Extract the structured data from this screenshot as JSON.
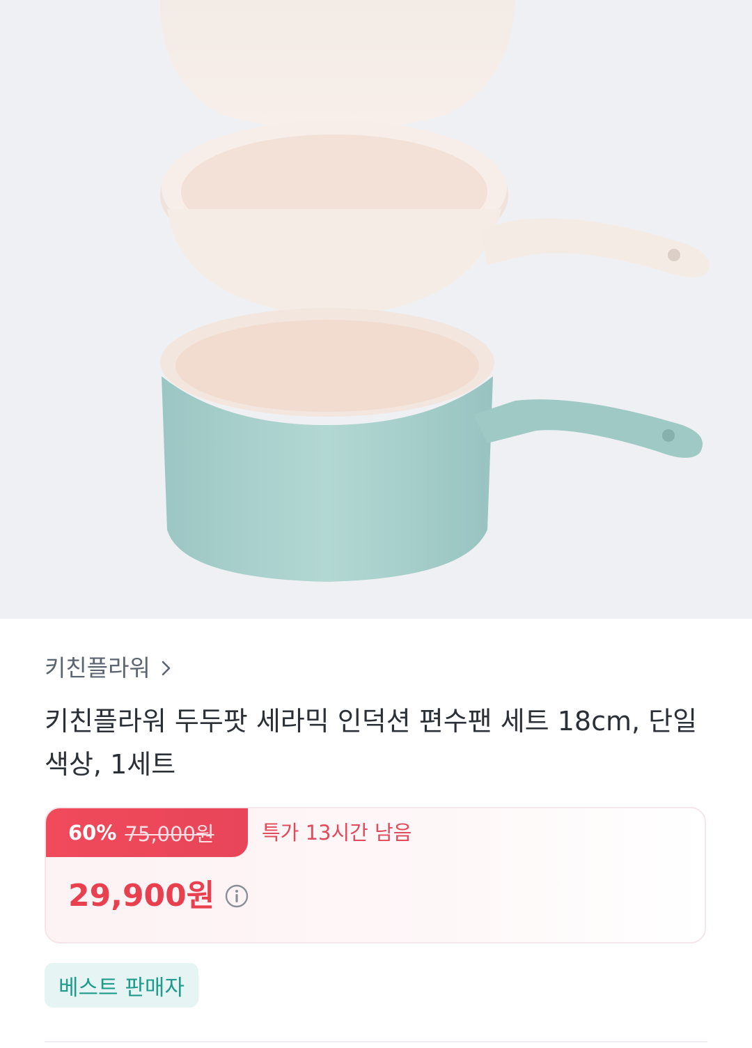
{
  "product": {
    "image_alt": "product-image",
    "brand": "키친플라워",
    "title": "키친플라워 두두팟 세라믹 인덕션 편수팬 세트 18cm, 단일색상, 1세트",
    "discount_rate": "60%",
    "original_price": "75,000원",
    "deal_timer": "특가 13시간 남음",
    "sale_price": "29,900원",
    "seller_badge": "베스트 판매자"
  },
  "colors": {
    "accent_red": "#e8404f",
    "badge_green": "#1f9b8c",
    "pan_cream": "#f6ece6",
    "pot_mint": "#a9cfcc"
  },
  "icons": {
    "brand_chevron": "chevron-right-icon",
    "price_info": "info-icon"
  }
}
